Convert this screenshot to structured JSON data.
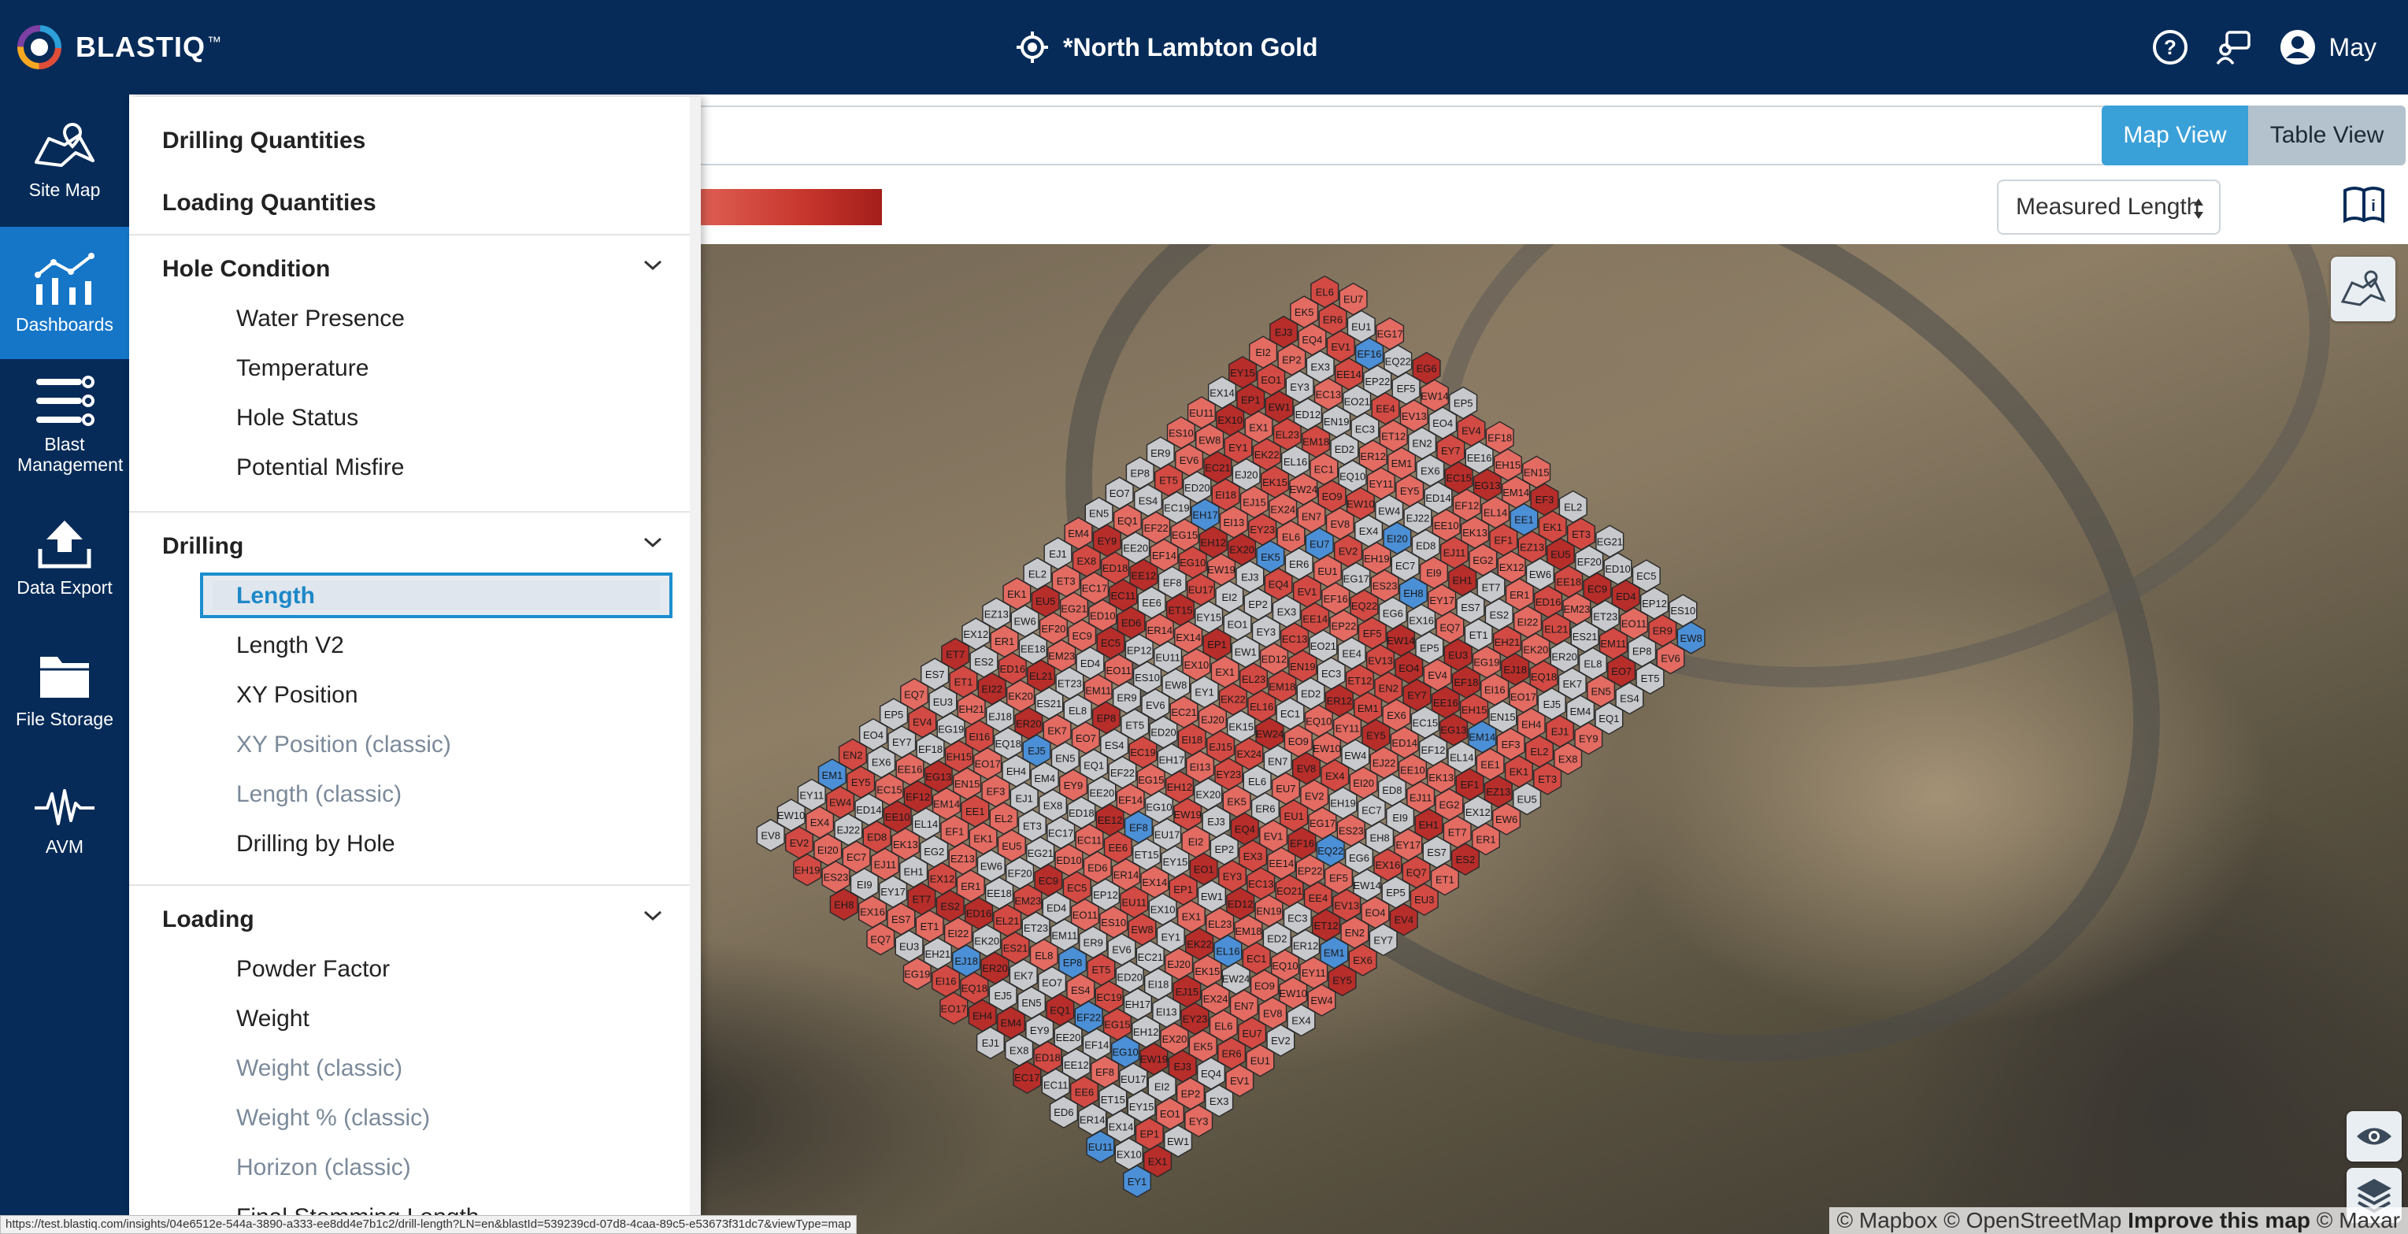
{
  "brand": {
    "name": "BLASTIQ",
    "mark": "™"
  },
  "header": {
    "site_title": "*North Lambton Gold",
    "user_name": "May"
  },
  "rail": {
    "items": [
      {
        "label": "Site Map",
        "icon": "site-map-icon"
      },
      {
        "label": "Dashboards",
        "icon": "dashboards-icon",
        "active": true
      },
      {
        "label": "Blast Management",
        "icon": "blast-management-icon"
      },
      {
        "label": "Data Export",
        "icon": "upload-icon"
      },
      {
        "label": "File Storage",
        "icon": "folder-icon"
      },
      {
        "label": "AVM",
        "icon": "waveform-icon"
      }
    ]
  },
  "menu": {
    "top_items": [
      "Drilling Quantities",
      "Loading Quantities"
    ],
    "hole_condition": {
      "title": "Hole Condition",
      "items": [
        "Water Presence",
        "Temperature",
        "Hole Status",
        "Potential Misfire"
      ]
    },
    "drilling": {
      "title": "Drilling",
      "items": [
        "Length",
        "Length V2",
        "XY Position",
        "XY Position (classic)",
        "Length (classic)",
        "Drilling by Hole"
      ],
      "selected": "Length"
    },
    "loading": {
      "title": "Loading",
      "items": [
        "Powder Factor",
        "Weight",
        "Weight (classic)",
        "Weight % (classic)",
        "Horizon (classic)",
        "Final Stemming Length"
      ]
    }
  },
  "toolbar": {
    "map_view": "Map View",
    "table_view": "Table View",
    "measure": "Measured Length"
  },
  "map": {
    "attribution_prefix": "© Mapbox © OpenStreetMap",
    "improve": "Improve this map",
    "attribution_suffix": "© Maxar",
    "legend_colors": [
      "#e2665a",
      "#a41e1a"
    ],
    "cell_colors": {
      "light": "#e36b62",
      "mid": "#d24a43",
      "dark": "#b72d2a",
      "grey": "#c7c9cc",
      "blue": "#4b8fd6"
    }
  },
  "holes": {
    "labels_sample": [
      "EY1",
      "EX1",
      "EW1",
      "EY3",
      "EX3",
      "EV1",
      "EU1",
      "EV2",
      "EX4",
      "EW4",
      "EY5",
      "EX6",
      "EY7",
      "EV4",
      "EU3",
      "ET1",
      "ES2",
      "ER1",
      "EW6",
      "EU5",
      "ET3",
      "EX8",
      "EY9",
      "EQ1",
      "ES4",
      "ET5",
      "EV6",
      "EW8",
      "EX10",
      "EP1",
      "EO1",
      "EP2",
      "EQ4",
      "ER6",
      "EU7",
      "EV8",
      "EW10",
      "EY11",
      "EM1",
      "EN2",
      "EO4",
      "EP5",
      "EQ7",
      "ES7",
      "ET7",
      "EX12",
      "EZ13",
      "EK1",
      "EL2",
      "EJ1",
      "EM4",
      "EN5",
      "EO7",
      "EP8",
      "ER9",
      "ES10",
      "EU11",
      "EX14",
      "EY15",
      "EI2",
      "EJ3",
      "EK5",
      "EL6",
      "EN7",
      "EO9",
      "EQ10",
      "ER12",
      "ET12",
      "EV13",
      "EW14",
      "EX16",
      "EY17",
      "EH1",
      "EG2",
      "EF1",
      "EE1",
      "EF3",
      "EH4",
      "EJ5",
      "EK7",
      "EL8",
      "EM11",
      "EO11",
      "EP12",
      "ER14",
      "ET15",
      "EU17",
      "EW19",
      "EX20",
      "EY23",
      "EX24",
      "EW24",
      "EC1",
      "ED2",
      "EC3",
      "EE4",
      "EF5",
      "EG6",
      "EH8",
      "EI9",
      "EJ11",
      "EK13",
      "EL14",
      "EM14",
      "EN15",
      "EO17",
      "EQ18",
      "ER20",
      "ES21",
      "ET23",
      "ED4",
      "EC5",
      "ED6",
      "EE6",
      "EF8",
      "EG10",
      "EH12",
      "EI13",
      "EJ15",
      "EK15",
      "EL16",
      "EM18",
      "EN19",
      "EO21",
      "EP22",
      "EQ22",
      "ES23",
      "EC7",
      "ED8",
      "EE10",
      "EF12",
      "EG13",
      "EH15",
      "EI16",
      "EJ18",
      "EK20",
      "EL21",
      "EM23",
      "EC9",
      "ED10",
      "EC11",
      "EE12",
      "EF14",
      "EG15",
      "EH17",
      "EI18",
      "EJ20",
      "EK22",
      "EL23",
      "ED12",
      "EC13",
      "EE14",
      "EF16",
      "EG17",
      "EH19",
      "EI20",
      "EJ22",
      "ED14",
      "EC15",
      "EE16",
      "EF18",
      "EG19",
      "EH21",
      "EI22",
      "ED16",
      "EE18",
      "EF20",
      "EG21",
      "EC17",
      "ED18",
      "EE20",
      "EF22",
      "EC19",
      "ED20",
      "EC21"
    ]
  },
  "status": {
    "url": "https://test.blastiq.com/insights/04e6512e-544a-3890-a333-ee8dd4e7b1c2/drill-length?LN=en&blastId=539239cd-07d8-4caa-89c5-e53673f31dc7&viewType=map"
  }
}
